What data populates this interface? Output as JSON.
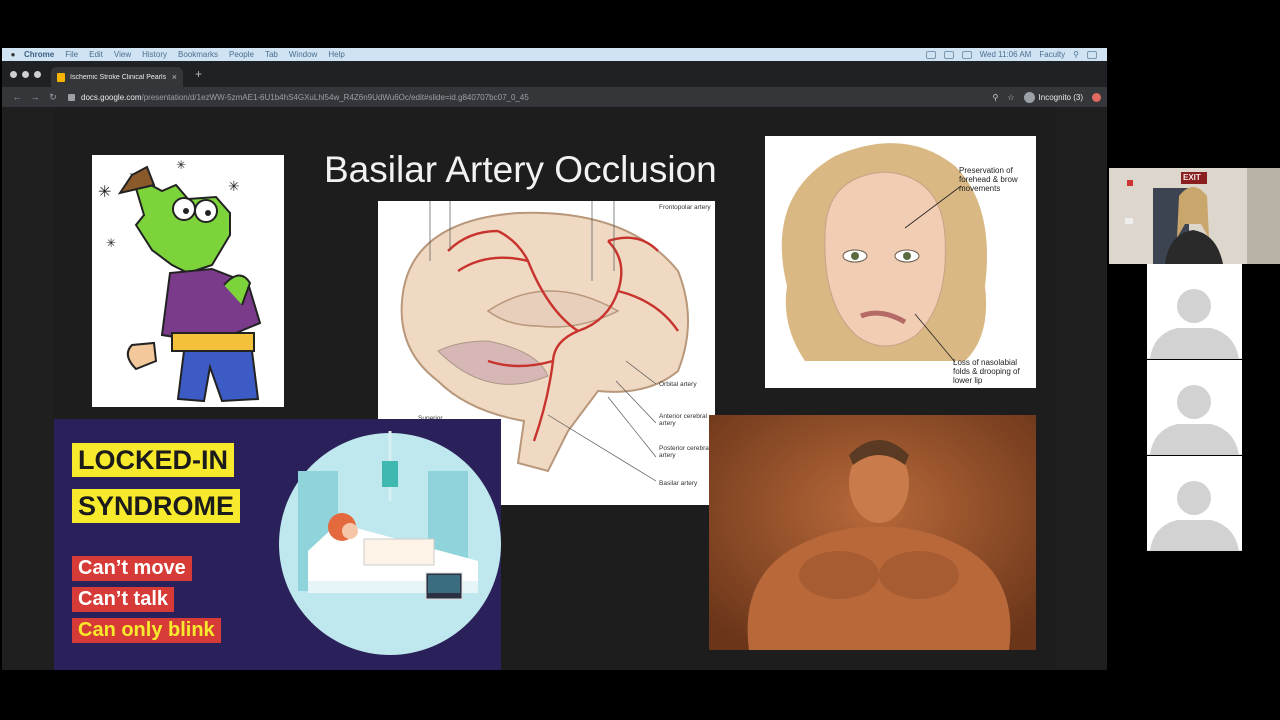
{
  "menubar": {
    "items": [
      "Chrome",
      "File",
      "Edit",
      "View",
      "History",
      "Bookmarks",
      "People",
      "Tab",
      "Window",
      "Help"
    ],
    "clock": "Wed 11:06 AM",
    "user": "Faculty"
  },
  "browser": {
    "tab_title": "Ischemic Stroke Clinical Pearls -",
    "url_host": "docs.google.com",
    "url_path": "/presentation/d/1ezWW-5zmAE1-6U1b4hS4GXuLhl54w_R4Z6n9UdWu6Oc/edit#slide=id.g840707bc07_0_45",
    "profile": "Incognito (3)"
  },
  "slide": {
    "title": "Basilar Artery Occlusion",
    "brain_labels": [
      "Frontopolar artery",
      "Orbital artery",
      "Anterior cerebral artery",
      "Posterior cerebral artery",
      "Basilar artery",
      "Superior"
    ],
    "face_labels": [
      "Preservation of forehead & brow movements",
      "Loss of nasolabial folds & drooping of lower lip"
    ],
    "locked_in": {
      "title_line1": "LOCKED-IN",
      "title_line2": "SYNDROME",
      "bullets": [
        "Can’t move",
        "Can’t talk",
        "Can only blink"
      ]
    }
  },
  "video": {
    "exit_sign": "EXIT"
  },
  "colors": {
    "menubar": "#cfe3f3",
    "slide_bg": "#1d1d1d",
    "locked_bg": "#2a205a",
    "highlight_yellow": "#f7ea2d",
    "pill_red": "#d63b37",
    "artery_red": "#c8342d"
  }
}
